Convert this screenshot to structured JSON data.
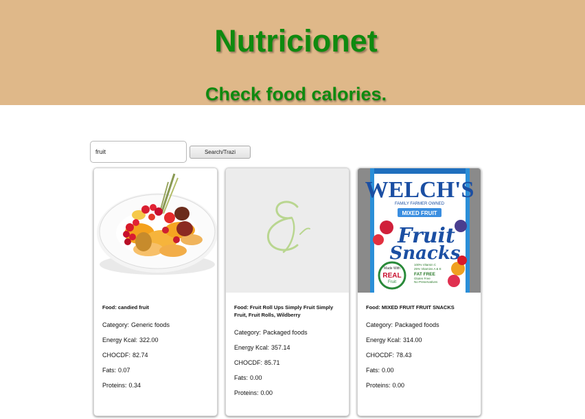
{
  "header": {
    "title": "Nutricionet",
    "subtitle": "Check food calories."
  },
  "search": {
    "value": "fruit",
    "button_label": "Search/Trazi"
  },
  "labels": {
    "food": "Food:",
    "category": "Category:",
    "energy": "Energy Kcal:",
    "chocdf": "CHOCDF:",
    "fats": "Fats:",
    "proteins": "Proteins:"
  },
  "results": [
    {
      "image": "candied-fruit-photo",
      "food": "candied fruit",
      "category": "Generic foods",
      "energy": "322.00",
      "chocdf": "82.74",
      "fats": "0.07",
      "proteins": "0.34"
    },
    {
      "image": "placeholder-logo",
      "food": "Fruit Roll Ups Simply Fruit Simply Fruit, Fruit Rolls, Wildberry",
      "category": "Packaged foods",
      "energy": "357.14",
      "chocdf": "85.71",
      "fats": "0.00",
      "proteins": "0.00"
    },
    {
      "image": "welchs-package-photo",
      "image_text": {
        "brand": "WELCH'S",
        "tagline": "FAMILY FARMER OWNED",
        "badge": "MIXED FRUIT",
        "product_line1": "Fruit",
        "product_line2": "Snacks",
        "seal_line1": "Made With",
        "seal_line2": "REAL",
        "seal_line3": "Fruit",
        "claims1": "100% Vitamin C",
        "claims2": "25% Vitamins A & E",
        "claims3": "FAT FREE",
        "claims4": "Gluten Free",
        "claims5": "No Preservatives"
      },
      "food": "MIXED FRUIT FRUIT SNACKS",
      "category": "Packaged foods",
      "energy": "314.00",
      "chocdf": "78.43",
      "fats": "0.00",
      "proteins": "0.00"
    }
  ]
}
